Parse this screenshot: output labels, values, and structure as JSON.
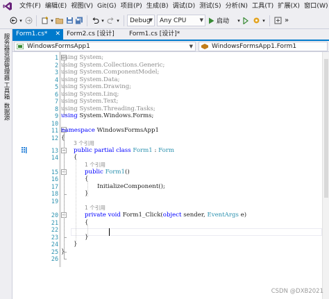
{
  "menubar": {
    "items": [
      "文件(F)",
      "编辑(E)",
      "视图(V)",
      "Git(G)",
      "项目(P)",
      "生成(B)",
      "调试(D)",
      "测试(S)",
      "分析(N)",
      "工具(T)",
      "扩展(X)",
      "窗口(W)"
    ]
  },
  "toolbar": {
    "config": "Debug",
    "platform": "Any CPU",
    "start_label": "启动"
  },
  "leftstrip": {
    "tabs": [
      "服务器资源管理器",
      "工具箱",
      "数据源"
    ]
  },
  "tabs": [
    {
      "label": "Form1.cs*",
      "active": true
    },
    {
      "label": "Form2.cs [设计]",
      "active": false
    },
    {
      "label": "Form1.cs [设计]*",
      "active": false
    }
  ],
  "navbar": {
    "project": "WindowsFormsApp1",
    "type": "WindowsFormsApp1.Form1"
  },
  "code": {
    "line_numbers": [
      "1",
      "2",
      "3",
      "4",
      "5",
      "6",
      "7",
      "8",
      "9",
      "10",
      "11",
      "12",
      "13",
      "14",
      "15",
      "16",
      "17",
      "18",
      "19",
      "20",
      "21",
      "22",
      "23",
      "24",
      "25",
      "26"
    ],
    "usings": [
      "System",
      "System.Collections.Generic",
      "System.ComponentModel",
      "System.Data",
      "System.Drawing",
      "System.Linq",
      "System.Text",
      "System.Threading.Tasks",
      "System.Windows.Forms"
    ],
    "using_kw": "using",
    "namespace_kw": "namespace",
    "namespace_name": "WindowsFormsApp1",
    "ref_3": "3 个引用",
    "ref_1a": "1 个引用",
    "ref_1b": "1 个引用",
    "class_mods": "public partial class",
    "class_name": "Form1",
    "base_sep": " : ",
    "base_name": "Form",
    "ctor_kw": "public",
    "ctor_name": "Form1",
    "ctor_parens": "()",
    "init_call": "InitializeComponent();",
    "method_mods": "private void",
    "method_name": "Form1_Click(",
    "param1_kw": "object",
    "param1_name": " sender, ",
    "param2_type": "EventArgs",
    "param2_name": " e)",
    "open_brace": "{",
    "close_brace": "}"
  },
  "watermark": "CSDN @DXB2021"
}
